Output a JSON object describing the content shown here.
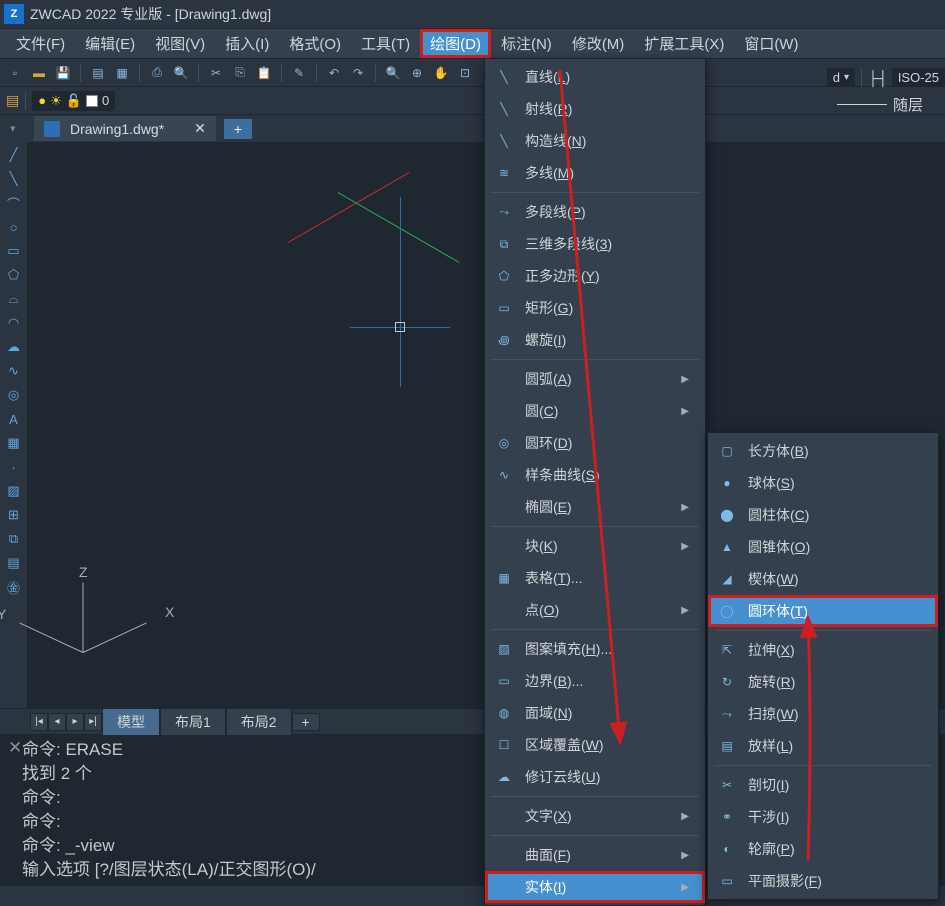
{
  "title": "ZWCAD 2022 专业版 - [Drawing1.dwg]",
  "logo": "Z",
  "menubar": [
    "文件(F)",
    "编辑(E)",
    "视图(V)",
    "插入(I)",
    "格式(O)",
    "工具(T)",
    "绘图(D)",
    "标注(N)",
    "修改(M)",
    "扩展工具(X)",
    "窗口(W)"
  ],
  "menubar_active_index": 6,
  "toolbar_combo": "d",
  "dim_style": "ISO-25",
  "linetype_label": "随层",
  "layer_value": "0",
  "doc_tab": "Drawing1.dwg*",
  "ucs": {
    "z": "Z",
    "y": "Y",
    "x": "X"
  },
  "layout_tabs": [
    "模型",
    "布局1",
    "布局2"
  ],
  "layout_active": 0,
  "cmd_lines": [
    "命令:  ERASE",
    "找到 2 个",
    "命令:",
    "命令:",
    "命令: _-view",
    "输入选项 [?/图层状态(LA)/正交图形(O)/"
  ],
  "draw_menu": [
    {
      "icon": "╲",
      "label": "直线(L)"
    },
    {
      "icon": "╲",
      "label": "射线(R)"
    },
    {
      "icon": "╲",
      "label": "构造线(N)"
    },
    {
      "icon": "≋",
      "label": "多线(M)"
    },
    {
      "sep": true
    },
    {
      "icon": "⤳",
      "label": "多段线(P)"
    },
    {
      "icon": "⧉",
      "label": "三维多段线(3)"
    },
    {
      "icon": "⬠",
      "label": "正多边形(Y)"
    },
    {
      "icon": "▭",
      "label": "矩形(G)"
    },
    {
      "icon": "꩜",
      "label": "螺旋(I)"
    },
    {
      "sep": true
    },
    {
      "icon": "",
      "label": "圆弧(A)",
      "sub": true
    },
    {
      "icon": "",
      "label": "圆(C)",
      "sub": true
    },
    {
      "icon": "◎",
      "label": "圆环(D)"
    },
    {
      "icon": "∿",
      "label": "样条曲线(S)"
    },
    {
      "icon": "",
      "label": "椭圆(E)",
      "sub": true
    },
    {
      "sep": true
    },
    {
      "icon": "",
      "label": "块(K)",
      "sub": true
    },
    {
      "icon": "▦",
      "label": "表格(T)..."
    },
    {
      "icon": "",
      "label": "点(O)",
      "sub": true
    },
    {
      "sep": true
    },
    {
      "icon": "▨",
      "label": "图案填充(H)..."
    },
    {
      "icon": "▭",
      "label": "边界(B)..."
    },
    {
      "icon": "◍",
      "label": "面域(N)"
    },
    {
      "icon": "☐",
      "label": "区域覆盖(W)"
    },
    {
      "icon": "☁",
      "label": "修订云线(U)"
    },
    {
      "sep": true
    },
    {
      "icon": "",
      "label": "文字(X)",
      "sub": true
    },
    {
      "sep": true
    },
    {
      "icon": "",
      "label": "曲面(F)",
      "sub": true
    },
    {
      "icon": "",
      "label": "实体(I)",
      "sub": true,
      "hl": true,
      "boxed": true
    }
  ],
  "solid_submenu": [
    {
      "icon": "▢",
      "label": "长方体(B)"
    },
    {
      "icon": "●",
      "label": "球体(S)"
    },
    {
      "icon": "⬤",
      "label": "圆柱体(C)"
    },
    {
      "icon": "▲",
      "label": "圆锥体(O)"
    },
    {
      "icon": "◢",
      "label": "楔体(W)"
    },
    {
      "icon": "◯",
      "label": "圆环体(T)",
      "hl": true,
      "boxed": true
    },
    {
      "sep": true
    },
    {
      "icon": "⇱",
      "label": "拉伸(X)"
    },
    {
      "icon": "↻",
      "label": "旋转(R)"
    },
    {
      "icon": "⤳",
      "label": "扫掠(W)"
    },
    {
      "icon": "▤",
      "label": "放样(L)"
    },
    {
      "sep": true
    },
    {
      "icon": "✂",
      "label": "剖切(I)"
    },
    {
      "icon": "⚭",
      "label": "干涉(I)"
    },
    {
      "icon": "◐",
      "label": "轮廓(P)"
    },
    {
      "icon": "▭",
      "label": "平面摄影(F)"
    }
  ]
}
